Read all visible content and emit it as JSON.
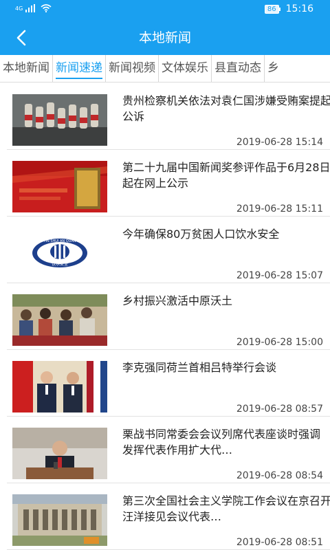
{
  "status_bar": {
    "network": "4G",
    "battery": "86",
    "time": "15:16",
    "icons": [
      "signal-icon",
      "wifi-icon",
      "battery-icon"
    ]
  },
  "header": {
    "title": "本地新闻",
    "back_icon": "chevron-left-icon"
  },
  "tabs": [
    {
      "label": "本地新闻",
      "active": false
    },
    {
      "label": "新闻速递",
      "active": true
    },
    {
      "label": "新闻视频",
      "active": false
    },
    {
      "label": "文体娱乐",
      "active": false
    },
    {
      "label": "县直动态",
      "active": false
    },
    {
      "label": "乡",
      "active": false
    }
  ],
  "news": [
    {
      "title": "贵州检察机关依法对袁仁国涉嫌受贿案提起公诉",
      "time": "2019-06-28 15:14"
    },
    {
      "title": "第二十九届中国新闻奖参评作品于6月28日起在网上公示",
      "time": "2019-06-28 15:11"
    },
    {
      "title": "今年确保80万贫困人口饮水安全",
      "time": "2019-06-28 15:07",
      "logo_text": "YIN SHUI AN QUAN",
      "logo_caption": "饮水安全"
    },
    {
      "title": "乡村振兴激活中原沃土",
      "time": "2019-06-28 15:00"
    },
    {
      "title": "李克强同荷兰首相吕特举行会谈",
      "time": "2019-06-28 08:57"
    },
    {
      "title": "栗战书同常委会会议列席代表座谈时强调 发挥代表作用扩大代…",
      "time": "2019-06-28 08:54"
    },
    {
      "title": "第三次全国社会主义学院工作会议在京召开 汪洋接见会议代表…",
      "time": "2019-06-28 08:51"
    }
  ],
  "colors": {
    "accent": "#1aa0f0",
    "divider": "#e2e2e2"
  }
}
